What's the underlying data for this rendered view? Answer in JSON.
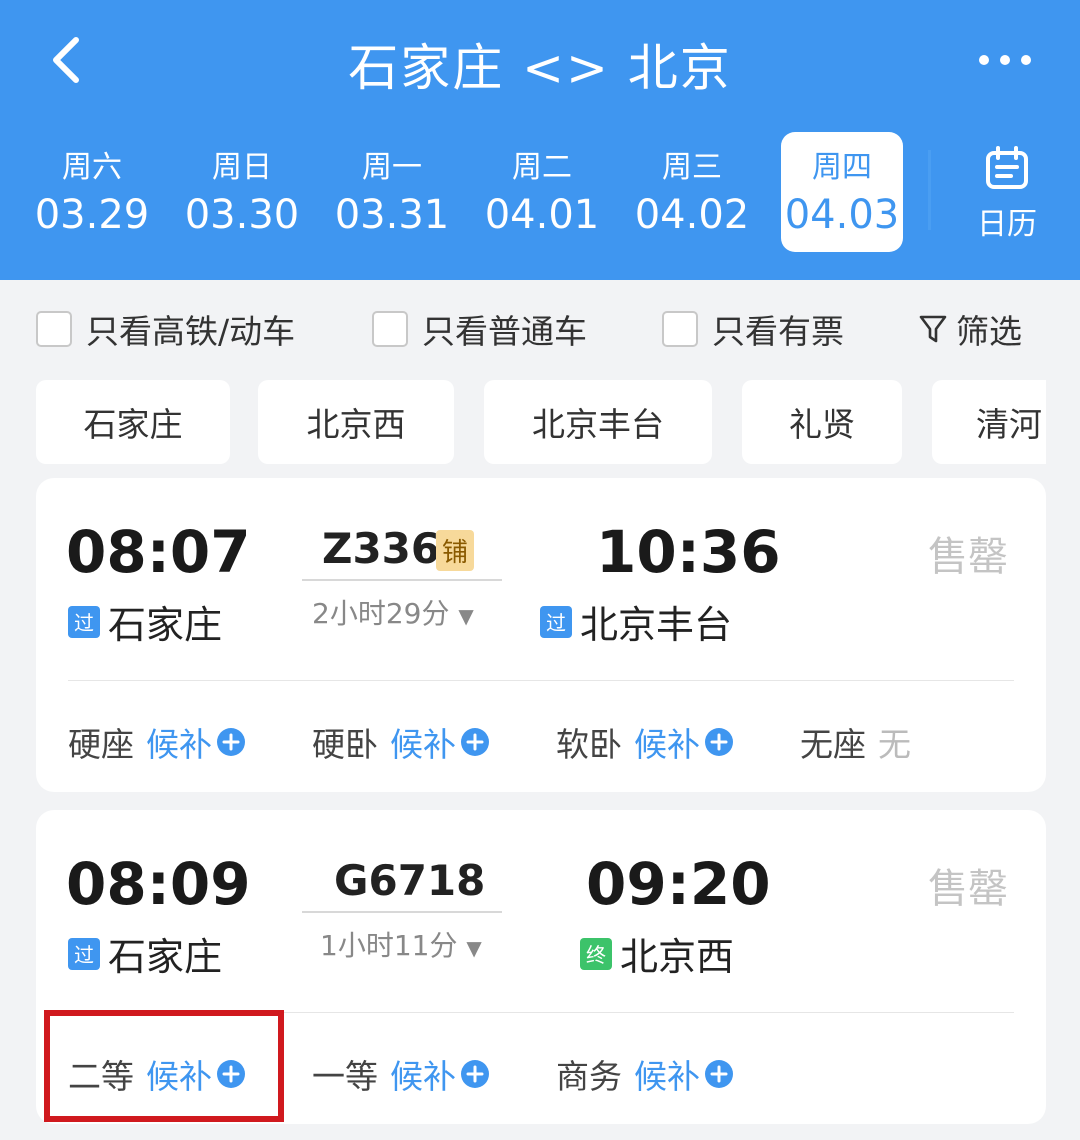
{
  "header": {
    "title": "石家庄 <> 北京",
    "back_icon": "chevron-left-icon",
    "more_icon": "more-dots-icon",
    "bg_color": "#3f96f0"
  },
  "dates": [
    {
      "weekday": "周六",
      "date": "03.29"
    },
    {
      "weekday": "周日",
      "date": "03.30"
    },
    {
      "weekday": "周一",
      "date": "03.31"
    },
    {
      "weekday": "周二",
      "date": "04.01"
    },
    {
      "weekday": "周三",
      "date": "04.02"
    },
    {
      "weekday": "周四",
      "date": "04.03",
      "selected": true
    }
  ],
  "calendar": {
    "label": "日历",
    "icon": "calendar-icon"
  },
  "filters": {
    "high_speed": "只看高铁/动车",
    "regular": "只看普通车",
    "available": "只看有票",
    "filter_label": "筛选",
    "filter_icon": "funnel-icon"
  },
  "stations": [
    "石家庄",
    "北京西",
    "北京丰台",
    "礼贤",
    "清河"
  ],
  "trains": [
    {
      "departure_time": "08:07",
      "train_number": "Z336",
      "berth_badge": "铺",
      "duration": "2小时29分",
      "arrival_time": "10:36",
      "from_station": "石家庄",
      "from_tag": "过",
      "to_station": "北京丰台",
      "to_tag": "过",
      "status": "售罄",
      "seats": [
        {
          "class": "硬座",
          "status": "候补"
        },
        {
          "class": "硬卧",
          "status": "候补"
        },
        {
          "class": "软卧",
          "status": "候补"
        },
        {
          "class": "无座",
          "status": "无"
        }
      ]
    },
    {
      "departure_time": "08:09",
      "train_number": "G6718",
      "duration": "1小时11分",
      "arrival_time": "09:20",
      "from_station": "石家庄",
      "from_tag": "过",
      "to_station": "北京西",
      "to_tag": "终",
      "status": "售罄",
      "seats": [
        {
          "class": "二等",
          "status": "候补"
        },
        {
          "class": "一等",
          "status": "候补"
        },
        {
          "class": "商务",
          "status": "候补"
        }
      ]
    }
  ],
  "colors": {
    "accent": "#3f96f0",
    "sold_out": "#c4c4c4",
    "highlight": "#d0191e",
    "end_tag": "#3cc36a"
  }
}
